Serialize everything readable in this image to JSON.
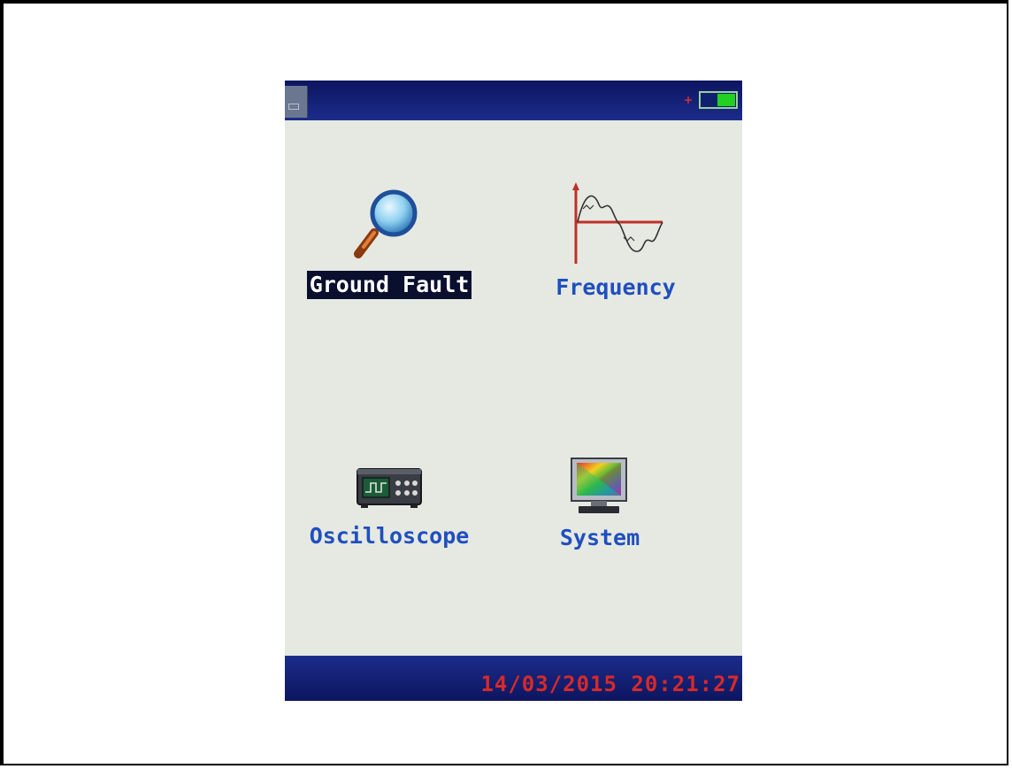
{
  "status_bar": {
    "left_icon": "storage-icon",
    "power_icon": "plug-icon",
    "battery_icon": "battery-icon",
    "battery_level": 0.5,
    "colors": {
      "bar": "#0d1560",
      "battery_fill": "#22d022",
      "plug": "#ff3030"
    }
  },
  "menu": {
    "items": [
      {
        "label": "Ground Fault",
        "icon": "magnifier-icon",
        "selected": true
      },
      {
        "label": "Frequency",
        "icon": "waveform-icon",
        "selected": false
      },
      {
        "label": "Oscilloscope",
        "icon": "oscilloscope-icon",
        "selected": false
      },
      {
        "label": "System",
        "icon": "monitor-icon",
        "selected": false
      }
    ],
    "colors": {
      "label": "#1f4fbf",
      "selected_bg": "#0a0f2e",
      "selected_text": "#ffffff"
    }
  },
  "footer": {
    "datetime": "14/03/2015 20:21:27",
    "color": "#d62a2a"
  }
}
